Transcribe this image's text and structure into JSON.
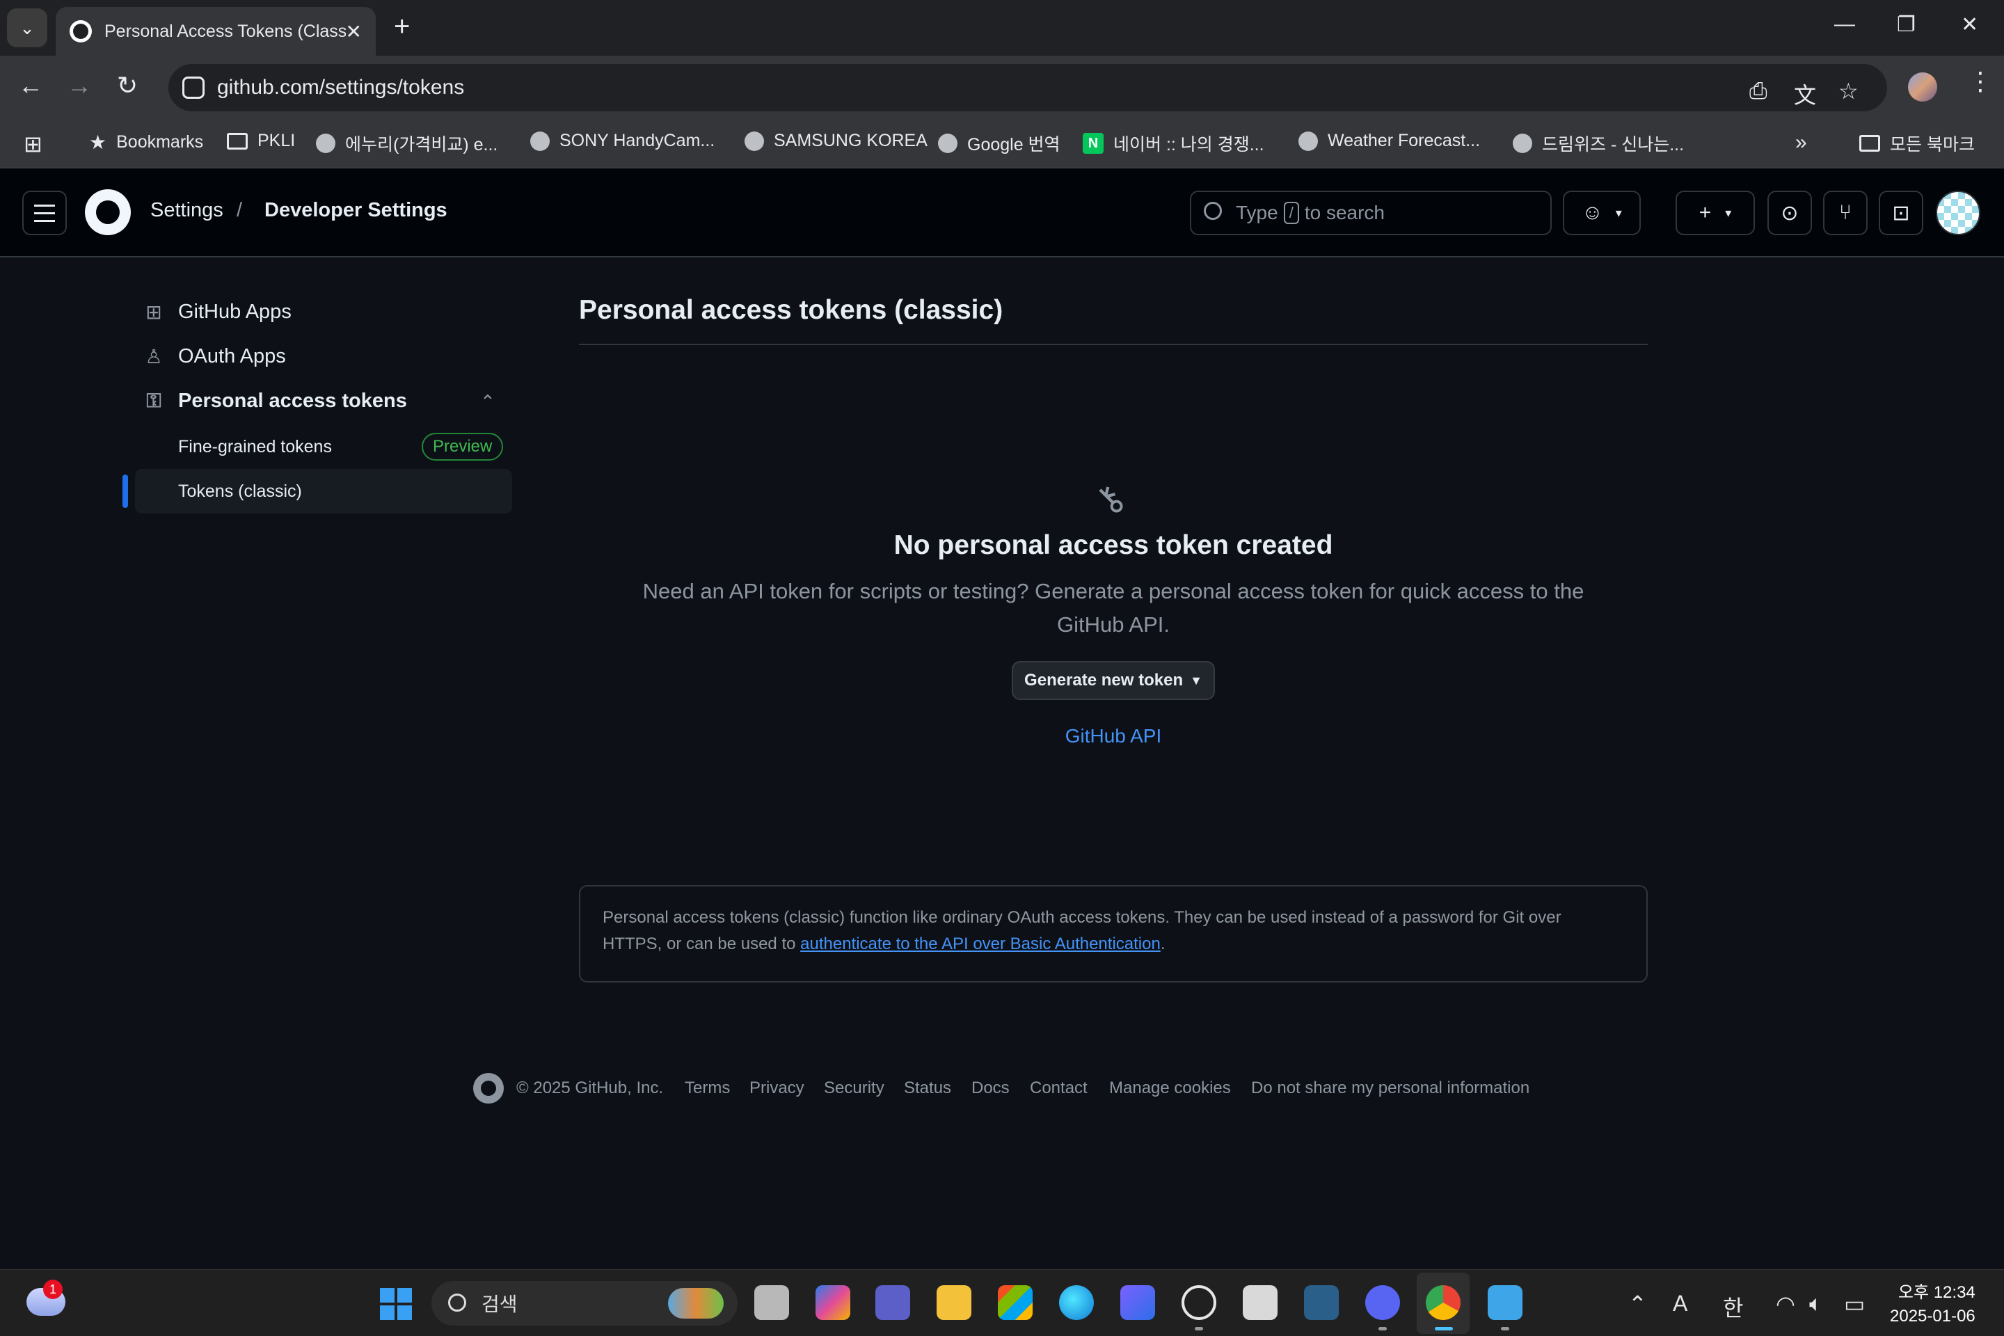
{
  "browser": {
    "tab_title": "Personal Access Tokens (Classic)",
    "url": "github.com/settings/tokens",
    "bookmarks": [
      "Bookmarks",
      "PKLI",
      "에누리(가격비교) e...",
      "SONY HandyCam...",
      "SAMSUNG KOREA",
      "Google 번역",
      "네이버 :: 나의 경쟁...",
      "Weather Forecast...",
      "드림위즈 - 신나는...",
      "모든 북마크"
    ]
  },
  "header": {
    "breadcrumb": [
      "Settings",
      "/",
      "Developer Settings"
    ],
    "search_prefix": "Type",
    "search_key": "/",
    "search_suffix": "to search"
  },
  "sidebar": {
    "items": [
      "GitHub Apps",
      "OAuth Apps",
      "Personal access tokens"
    ],
    "sub_items": [
      "Fine-grained tokens",
      "Tokens (classic)"
    ],
    "preview_badge": "Preview"
  },
  "main": {
    "title": "Personal access tokens (classic)",
    "blank_heading": "No personal access token created",
    "blank_text": "Need an API token for scripts or testing? Generate a personal access token for quick access to the GitHub API.",
    "generate_button": "Generate new token",
    "api_link": "GitHub API",
    "info_text": "Personal access tokens (classic) function like ordinary OAuth access tokens. They can be used instead of a password for Git over HTTPS, or can be used to",
    "info_link": "authenticate to the API over Basic Authentication",
    "info_end": "."
  },
  "footer": {
    "copyright": "© 2025 GitHub, Inc.",
    "links": [
      "Terms",
      "Privacy",
      "Security",
      "Status",
      "Docs",
      "Contact",
      "Manage cookies",
      "Do not share my personal information"
    ]
  },
  "taskbar": {
    "weather_badge": "1",
    "search_placeholder": "검색",
    "ime_a": "A",
    "ime_han": "한",
    "time": "오후 12:34",
    "date": "2025-01-06"
  },
  "colors": {
    "accent": "#1f6feb",
    "link": "#4493f8",
    "preview_green": "#3fb950",
    "bg": "#0d1117"
  }
}
